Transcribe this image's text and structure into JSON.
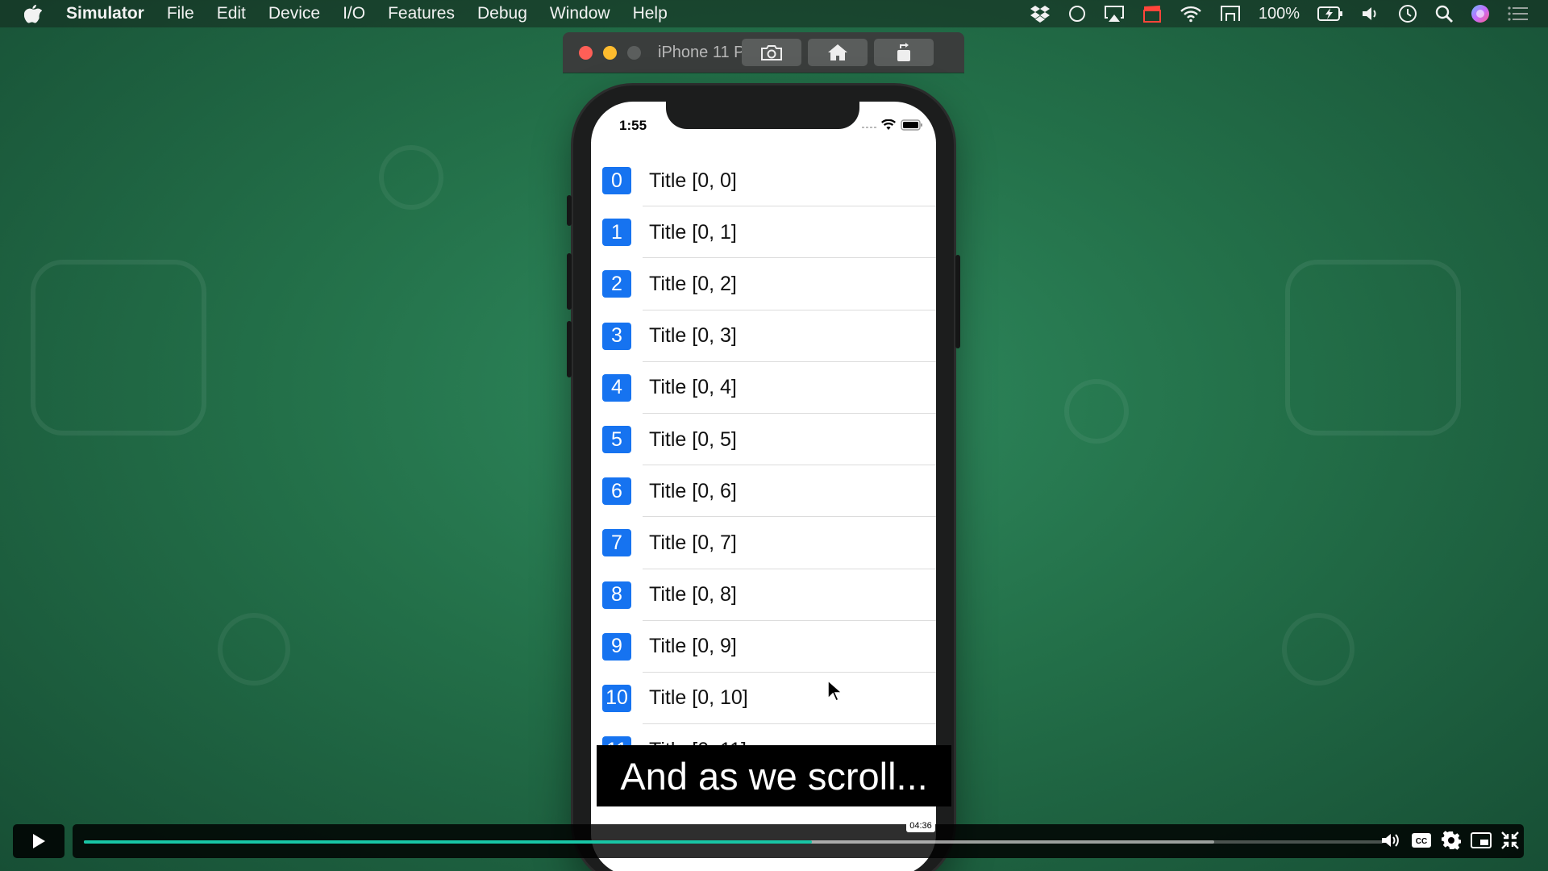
{
  "menubar": {
    "app_name": "Simulator",
    "items": [
      "File",
      "Edit",
      "Device",
      "I/O",
      "Features",
      "Debug",
      "Window",
      "Help"
    ],
    "battery": "100%"
  },
  "simulator": {
    "window_title": "iPhone 11 P...",
    "toolbar_buttons": [
      "screenshot-icon",
      "home-icon",
      "rotate-icon"
    ]
  },
  "phone": {
    "status_time": "1:55",
    "rows": [
      {
        "index": "0",
        "title": "Title [0, 0]"
      },
      {
        "index": "1",
        "title": "Title [0, 1]"
      },
      {
        "index": "2",
        "title": "Title [0, 2]"
      },
      {
        "index": "3",
        "title": "Title [0, 3]"
      },
      {
        "index": "4",
        "title": "Title [0, 4]"
      },
      {
        "index": "5",
        "title": "Title [0, 5]"
      },
      {
        "index": "6",
        "title": "Title [0, 6]"
      },
      {
        "index": "7",
        "title": "Title [0, 7]"
      },
      {
        "index": "8",
        "title": "Title [0, 8]"
      },
      {
        "index": "9",
        "title": "Title [0, 9]"
      },
      {
        "index": "10",
        "title": "Title [0, 10]"
      },
      {
        "index": "11",
        "title": "Title [0, 11]"
      }
    ],
    "accent_color": "#1673f0"
  },
  "caption": "And as we scroll...",
  "video": {
    "hover_time": "04:36",
    "progress_fraction": 0.56,
    "buffered_fraction": 0.87,
    "accent_color": "#18c6a6"
  }
}
